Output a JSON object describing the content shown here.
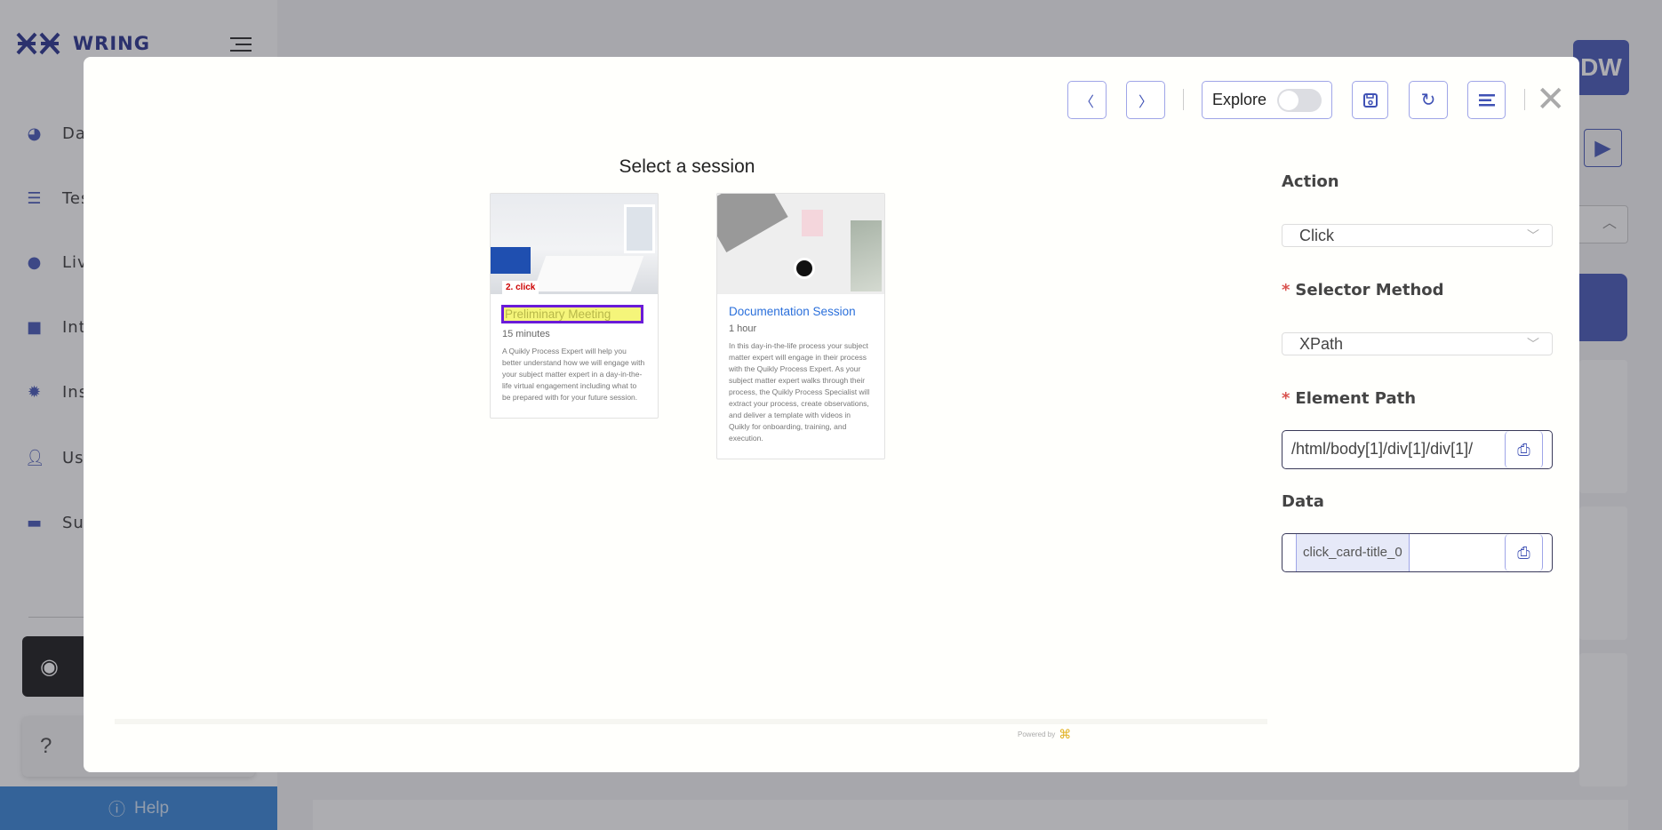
{
  "app": {
    "name": "WRING",
    "avatar_initials": "DW"
  },
  "sidebar": {
    "items": [
      {
        "label": "Das",
        "icon": "pie-chart-icon"
      },
      {
        "label": "Tes",
        "icon": "list-icon"
      },
      {
        "label": "Liv",
        "icon": "lightbulb-icon"
      },
      {
        "label": "Int",
        "icon": "cube-icon"
      },
      {
        "label": "Ins",
        "icon": "gear-icon"
      },
      {
        "label": "Use",
        "icon": "user-icon"
      },
      {
        "label": "Sub",
        "icon": "briefcase-icon"
      }
    ],
    "help_label": "Help"
  },
  "toolbar": {
    "explore_label": "Explore",
    "explore_on": false
  },
  "preview": {
    "title": "Select a session",
    "step_label": "2. click",
    "cards": [
      {
        "title": "Preliminary Meeting",
        "duration": "15 minutes",
        "description": "A Quikly Process Expert will help you better understand how we will engage with your subject matter expert in a day-in-the-life virtual engagement including what to be prepared with for your future session."
      },
      {
        "title": "Documentation Session",
        "duration": "1 hour",
        "description": "In this day-in-the-life process your subject matter expert will engage in their process with the Quikly Process Expert. As your subject matter expert walks through their process, the Quikly Process Specialist will extract your process, create observations, and deliver a template with videos in Quikly for onboarding, training, and execution."
      }
    ],
    "powered_by": "Powered by"
  },
  "panel": {
    "action_label": "Action",
    "action_value": "Click",
    "selector_label": "Selector Method",
    "selector_value": "XPath",
    "path_label": "Element Path",
    "path_value": "/html/body[1]/div[1]/div[1]/",
    "data_label": "Data",
    "data_value": "click_card-title_0",
    "required_mark": "*"
  },
  "colors": {
    "accent": "#3f51b5",
    "help": "#2f80d6",
    "highlight": "#f5f57a"
  }
}
